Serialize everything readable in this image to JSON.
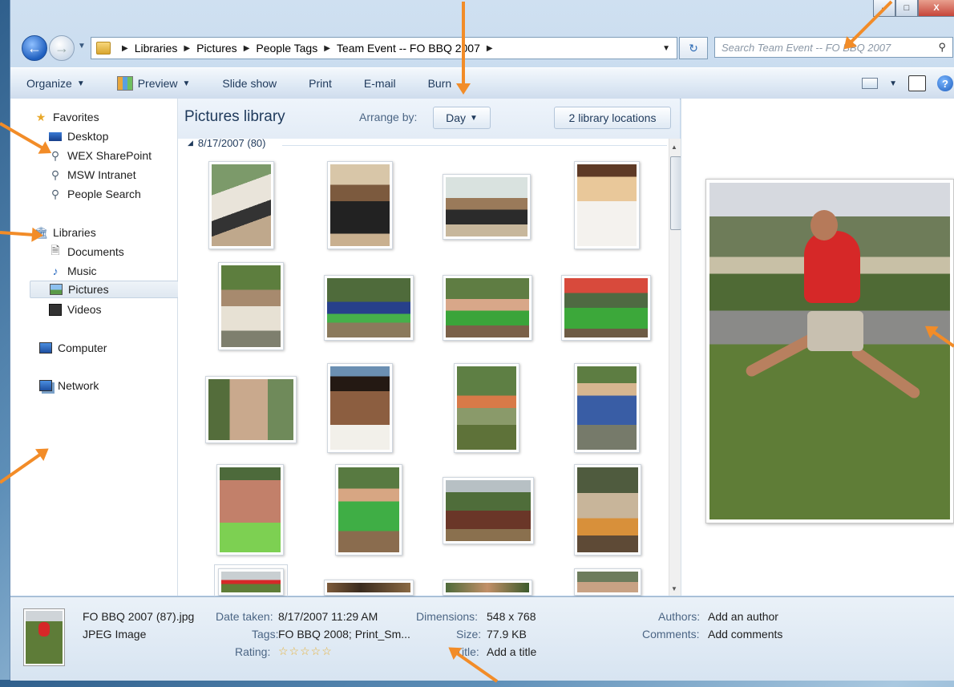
{
  "window": {
    "caption_buttons": {
      "minimize": "–",
      "maximize": "□",
      "close": "X"
    }
  },
  "address_bar": {
    "crumbs": [
      "Libraries",
      "Pictures",
      "People Tags",
      "Team Event -- FO BBQ 2007"
    ]
  },
  "search": {
    "placeholder": "Search Team Event -- FO BBQ 2007"
  },
  "toolbar": {
    "organize": "Organize",
    "preview": "Preview",
    "slideshow": "Slide show",
    "print": "Print",
    "email": "E-mail",
    "burn": "Burn"
  },
  "nav": {
    "favorites": {
      "label": "Favorites",
      "items": [
        "Desktop",
        "WEX SharePoint",
        "MSW Intranet",
        "People Search"
      ]
    },
    "libraries": {
      "label": "Libraries",
      "items": [
        "Documents",
        "Music",
        "Pictures",
        "Videos"
      ]
    },
    "computer": "Computer",
    "network": "Network"
  },
  "content": {
    "title": "Pictures library",
    "arrange_label": "Arrange by:",
    "arrange_value": "Day",
    "locations_button": "2 library locations",
    "group_label": "8/17/2007 (80)"
  },
  "details": {
    "filename": "FO BBQ 2007 (87).jpg",
    "filetype": "JPEG Image",
    "date_taken_label": "Date taken:",
    "date_taken": "8/17/2007 11:29 AM",
    "tags_label": "Tags:",
    "tags": "FO BBQ 2008; Print_Sm...",
    "rating_label": "Rating:",
    "rating_stars": "☆☆☆☆☆",
    "dimensions_label": "Dimensions:",
    "dimensions": "548 x 768",
    "size_label": "Size:",
    "size": "77.9 KB",
    "title_label": "Title:",
    "title": "Add a title",
    "authors_label": "Authors:",
    "authors": "Add an author",
    "comments_label": "Comments:",
    "comments": "Add comments"
  },
  "colors": {
    "accent": "#1e395b",
    "annotation_arrow": "#f28c28",
    "close_button": "#c6453a"
  }
}
